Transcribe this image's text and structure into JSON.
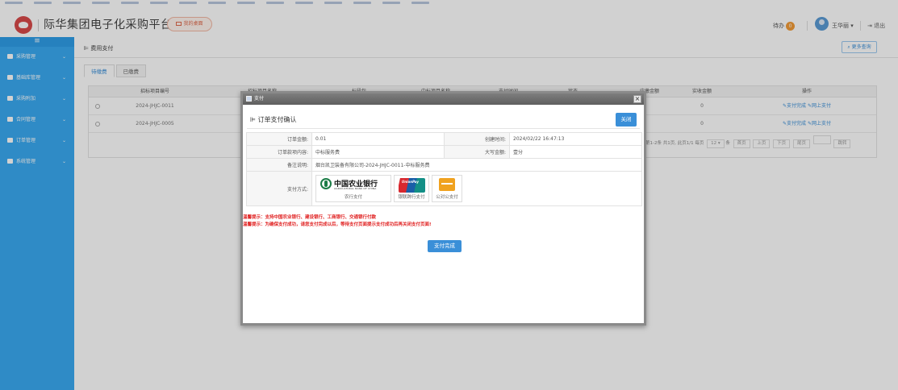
{
  "app": {
    "title": "际华集团电子化采购平台",
    "desk_label": "我的桌面",
    "todo_label": "待办",
    "todo_count": "0",
    "user_name": "王华丽",
    "logout_label": "退出"
  },
  "sidebar": {
    "items": [
      {
        "label": "采购管理"
      },
      {
        "label": "基础库管理"
      },
      {
        "label": "采购附加"
      },
      {
        "label": "合同管理"
      },
      {
        "label": "订单管理"
      },
      {
        "label": "系统管理"
      }
    ]
  },
  "main": {
    "page_title": "费用支付",
    "more_search": "更多查询",
    "tabs": [
      {
        "label": "待缴费"
      },
      {
        "label": "已缴费"
      }
    ],
    "columns": [
      "招标项目编号",
      "招标项目名称",
      "标段包",
      "中标项目名称",
      "支付时间",
      "状态",
      "应缴金额",
      "实收金额",
      "操作"
    ],
    "rows": [
      {
        "code": "2024-JHJC-0011",
        "received": "0",
        "op1": "支付完成",
        "op2": "网上支付"
      },
      {
        "code": "2024-JHJC-0005",
        "received": "0",
        "op1": "支付完成",
        "op2": "网上支付"
      }
    ],
    "pager": {
      "summary": "第1-2条 共1页, 此页1/1",
      "per_page_label": "每页",
      "per_page": "12",
      "unit": "条",
      "first": "首页",
      "prev": "上页",
      "next": "下页",
      "last": "尾页",
      "jump": "跳转"
    }
  },
  "modal": {
    "window_title": "支付",
    "dialog_title": "订单支付确认",
    "close_label": "关闭",
    "fields": {
      "amount_label": "订单金额:",
      "amount": "0.01",
      "created_label": "创建时间:",
      "created": "2024/02/22 16:47:13",
      "content_label": "订单款项内容:",
      "content": "中标服务费",
      "upper_label": "大写金额:",
      "upper": "壹分",
      "remark_label": "备注说明:",
      "remark": "烟台凯卫装备有限公司-2024-JHJC-0011-中标服务费",
      "paymethod_label": "支付方式:"
    },
    "pay_options": [
      {
        "brand_cn": "中国农业银行",
        "brand_en": "AGRICULTURAL BANK OF CHINA",
        "caption": "农行支付"
      },
      {
        "brand": "UnionPay",
        "caption": "银联跨行支付"
      },
      {
        "caption": "公对公支付"
      }
    ],
    "warning1": "温馨提示：支持中国农业银行、建设银行、工商银行、交通银行付款",
    "warning2": "温馨提示：为确保支付成功，请您支付完成以后，等待支付页面提示支付成功后再关闭支付页面!",
    "done_label": "支付完成"
  },
  "colors": {
    "sidebar": "#3aaaf2",
    "accent": "#3a8fd8",
    "warning": "#e02020",
    "titlebar": "#6e6e6e"
  }
}
